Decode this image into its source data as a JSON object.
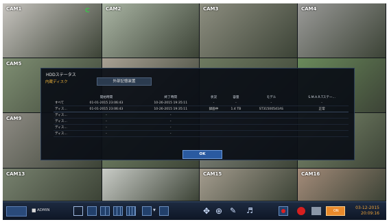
{
  "cameras": [
    {
      "label": "CAM1",
      "extra": "C",
      "bg": "#c7c4bf"
    },
    {
      "label": "CAM2",
      "bg": "#aab5a4"
    },
    {
      "label": "CAM3",
      "bg": "#8d8e80"
    },
    {
      "label": "CAM4",
      "bg": "#9a9a98"
    },
    {
      "label": "CAM5",
      "bg": "#7f8f73"
    },
    {
      "label": "",
      "bg": "#a9a194"
    },
    {
      "label": "",
      "bg": "#6e7a60"
    },
    {
      "label": "",
      "bg": "#6a8a5b"
    },
    {
      "label": "CAM9",
      "bg": "#8e8b84"
    },
    {
      "label": "",
      "bg": "#7a8b6c"
    },
    {
      "label": "",
      "bg": "#8c8f87"
    },
    {
      "label": "",
      "bg": "#7e8c6f"
    },
    {
      "label": "CAM13",
      "bg": "#78826f"
    },
    {
      "label": "",
      "bg": "#c9ccc7"
    },
    {
      "label": "CAM15",
      "bg": "#a59d8f"
    },
    {
      "label": "CAM16",
      "bg": "#a58c7a"
    }
  ],
  "dialog": {
    "title": "HDDステータス",
    "tab_internal": "内蔵ディスク",
    "tab_external": "外部記憶装置",
    "columns": [
      "",
      "開始時間",
      "終了時間",
      "状況",
      "容量",
      "モデル",
      "S.M.A.R.Tステー..."
    ],
    "rows": [
      [
        "すべて",
        "01-01-2015 23:06:43",
        "10-26-2015 19:35:11",
        "-",
        "-",
        "-",
        "-"
      ],
      [
        "ディス...",
        "01-01-2015 23:06:43",
        "10-26-2015 19:35:11",
        "録画中",
        "1.4 TB",
        "ST31500541AS",
        "正常"
      ],
      [
        "ディス...",
        "-",
        "-",
        "",
        "",
        "",
        ""
      ],
      [
        "ディス...",
        "-",
        "-",
        "",
        "",
        "",
        ""
      ],
      [
        "ディス...",
        "-",
        "-",
        "",
        "",
        "",
        ""
      ],
      [
        "ディス...",
        "-",
        "-",
        "",
        "",
        "",
        ""
      ]
    ],
    "ok_label": "OK"
  },
  "taskbar": {
    "user": "ADMIN",
    "date": "03-12-2015",
    "time": "20:09:16",
    "brand_color": "#2a5aa0",
    "accent_color": "#f0a53a"
  }
}
